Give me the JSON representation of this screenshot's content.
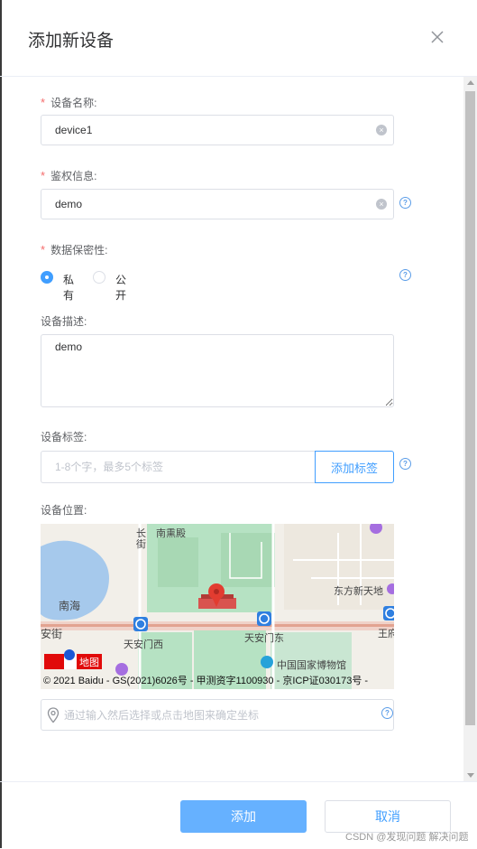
{
  "dialog": {
    "title": "添加新设备"
  },
  "form": {
    "device_name": {
      "label": "设备名称:",
      "value": "device1"
    },
    "auth": {
      "label": "鉴权信息:",
      "value": "demo"
    },
    "privacy": {
      "label": "数据保密性:",
      "options": [
        "私有",
        "公开"
      ],
      "selected": "私有"
    },
    "description": {
      "label": "设备描述:",
      "value": "demo"
    },
    "tags": {
      "label": "设备标签:",
      "placeholder": "1-8个字，最多5个标签",
      "add_button": "添加标签"
    },
    "location": {
      "label": "设备位置:",
      "placeholder": "通过输入然后选择或点击地图来确定坐标",
      "map": {
        "labels": [
          "长",
          "街",
          "南熏殿",
          "南海",
          "安街",
          "天安门西",
          "天安门东",
          "东方新天地",
          "王府",
          "中国国家博物馆"
        ],
        "logo": "地图",
        "copyright": "© 2021 Baidu - GS(2021)6026号 - 甲测资字1100930 - 京ICP证030173号 -"
      }
    }
  },
  "footer": {
    "confirm": "添加",
    "cancel": "取消",
    "watermark": "CSDN @发现问题 解决问题"
  },
  "colors": {
    "primary": "#409eff",
    "primary_light": "#66b1ff",
    "required": "#f56c6c"
  }
}
